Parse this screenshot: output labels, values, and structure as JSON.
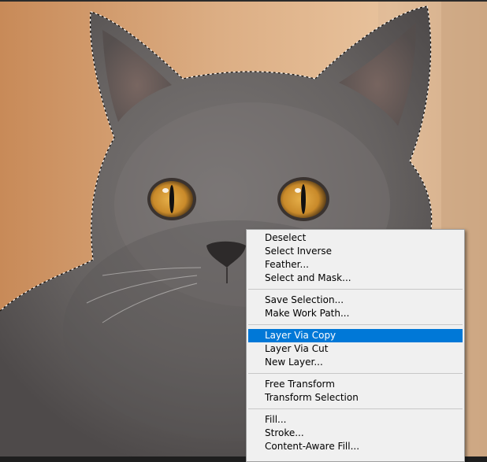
{
  "canvas": {
    "image_subject": "cat-photo"
  },
  "context_menu": {
    "groups": [
      {
        "items": [
          {
            "label": "Deselect"
          },
          {
            "label": "Select Inverse"
          },
          {
            "label": "Feather..."
          },
          {
            "label": "Select and Mask..."
          }
        ]
      },
      {
        "items": [
          {
            "label": "Save Selection..."
          },
          {
            "label": "Make Work Path..."
          }
        ]
      },
      {
        "items": [
          {
            "label": "Layer Via Copy",
            "highlighted": true
          },
          {
            "label": "Layer Via Cut"
          },
          {
            "label": "New Layer..."
          }
        ]
      },
      {
        "items": [
          {
            "label": "Free Transform"
          },
          {
            "label": "Transform Selection"
          }
        ]
      },
      {
        "items": [
          {
            "label": "Fill..."
          },
          {
            "label": "Stroke..."
          },
          {
            "label": "Content-Aware Fill..."
          }
        ]
      }
    ]
  },
  "colors": {
    "menu_background": "#f0f0f0",
    "menu_highlight": "#0078d7",
    "menu_highlight_text": "#ffffff",
    "menu_border": "#a0a0a0",
    "background_warm": "#c99063",
    "cat_fur": "#6f6b6a",
    "eye_amber": "#c98a2a"
  }
}
